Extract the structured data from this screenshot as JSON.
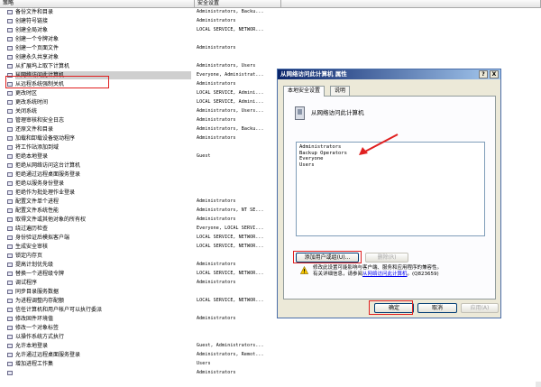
{
  "columns": {
    "policy": "策略",
    "setting": "安全设置"
  },
  "rows": [
    {
      "name": "备份文件和目录",
      "value": "Administrators, Backu..."
    },
    {
      "name": "创建符号链接",
      "value": "Administrators"
    },
    {
      "name": "创建全局对象",
      "value": "LOCAL SERVICE, NETWOR..."
    },
    {
      "name": "创建一个令牌对象",
      "value": ""
    },
    {
      "name": "创建一个页面文件",
      "value": "Administrators"
    },
    {
      "name": "创建永久共享对象",
      "value": ""
    },
    {
      "name": "从扩展坞上取下计算机",
      "value": "Administrators, Users"
    },
    {
      "name": "从网络访问此计算机",
      "value": "Everyone, Administrat..."
    },
    {
      "name": "从远程系统强制关机",
      "value": "Administrators"
    },
    {
      "name": "更改时区",
      "value": "LOCAL SERVICE, Admini..."
    },
    {
      "name": "更改系统时间",
      "value": "LOCAL SERVICE, Admini..."
    },
    {
      "name": "关闭系统",
      "value": "Administrators, Users..."
    },
    {
      "name": "管理审核和安全日志",
      "value": "Administrators"
    },
    {
      "name": "还原文件和目录",
      "value": "Administrators, Backu..."
    },
    {
      "name": "加载和卸载设备驱动程序",
      "value": "Administrators"
    },
    {
      "name": "将工作站添加到域",
      "value": ""
    },
    {
      "name": "拒绝本地登录",
      "value": "Guest"
    },
    {
      "name": "拒绝从网络访问这台计算机",
      "value": ""
    },
    {
      "name": "拒绝通过远程桌面服务登录",
      "value": ""
    },
    {
      "name": "拒绝以服务身份登录",
      "value": ""
    },
    {
      "name": "拒绝作为批处理作业登录",
      "value": ""
    },
    {
      "name": "配置文件单个进程",
      "value": "Administrators"
    },
    {
      "name": "配置文件系统性能",
      "value": "Administrators, NT SE..."
    },
    {
      "name": "取得文件或其他对象的所有权",
      "value": "Administrators"
    },
    {
      "name": "绕过遍历检查",
      "value": "Everyone, LOCAL SERVI..."
    },
    {
      "name": "身份验证后模拟客户端",
      "value": "LOCAL SERVICE, NETWOR..."
    },
    {
      "name": "生成安全审核",
      "value": "LOCAL SERVICE, NETWOR..."
    },
    {
      "name": "锁定内存页",
      "value": ""
    },
    {
      "name": "提高计划优先级",
      "value": "Administrators"
    },
    {
      "name": "替换一个进程级令牌",
      "value": "LOCAL SERVICE, NETWOR..."
    },
    {
      "name": "调试程序",
      "value": "Administrators"
    },
    {
      "name": "同步目录服务数据",
      "value": ""
    },
    {
      "name": "为进程调整内存配额",
      "value": "LOCAL SERVICE, NETWOR..."
    },
    {
      "name": "信任计算机和用户帐户可以执行委派",
      "value": ""
    },
    {
      "name": "修改固件环境值",
      "value": "Administrators"
    },
    {
      "name": "修改一个对象标签",
      "value": ""
    },
    {
      "name": "以操作系统方式执行",
      "value": ""
    },
    {
      "name": "允许本地登录",
      "value": "Guest, Administrators..."
    },
    {
      "name": "允许通过远程桌面服务登录",
      "value": "Administrators, Remot..."
    },
    {
      "name": "增加进程工作集",
      "value": "Users"
    },
    {
      "name": "",
      "value": "Administrators"
    }
  ],
  "dialog": {
    "title": "从网络访问此计算机 属性",
    "help_btn": "?",
    "close_btn": "X",
    "tabs": [
      "本地安全设置",
      "说明"
    ],
    "policy_name": "从网络访问此计算机",
    "users": [
      "Administrators",
      "Backup Operators",
      "Everyone",
      "Users"
    ],
    "add_button": "添加用户或组(U)...",
    "remove_button": "删除(R)",
    "info_text": "修改此设置可能影响与客户端、服务和应用程序的兼容性。",
    "info_more_prefix": "有关详细信息，请参阅",
    "info_link": "从网络访问此计算机",
    "info_more_suffix": "。(Q823659)",
    "ok": "确定",
    "cancel": "取消",
    "apply": "应用(A)"
  }
}
